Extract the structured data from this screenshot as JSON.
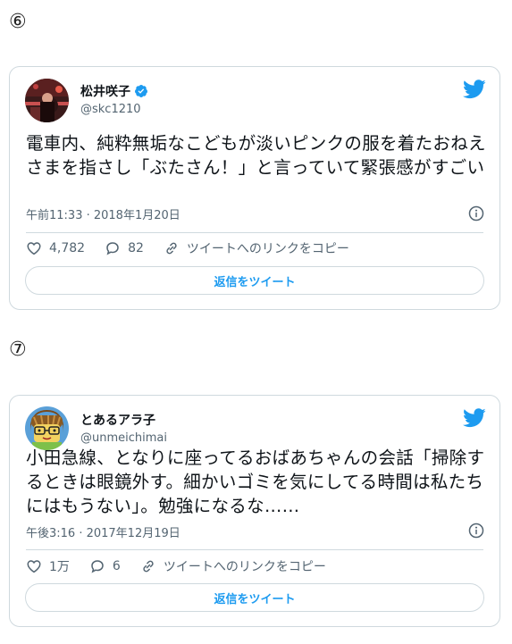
{
  "section_numbers": [
    "⑥",
    "⑦"
  ],
  "tweets": [
    {
      "author_name": "松井咲子",
      "verified": true,
      "handle": "@skc1210",
      "text": "電車内、純粋無垢なこどもが淡いピンクの服を着たおねえさまを指さし「ぶたさん！」と言っていて緊張感がすごい",
      "time": "午前11:33 · 2018年1月20日",
      "likes": "4,782",
      "replies": "82",
      "copy_link_label": "ツイートへのリンクをコピー",
      "reply_button_label": "返信をツイート"
    },
    {
      "author_name": "とあるアラ子",
      "verified": false,
      "handle": "@unmeichimai",
      "text": "小田急線、となりに座ってるおばあちゃんの会話「掃除するときは眼鏡外す。細かいゴミを気にしてる時間は私たちにはもうない」。勉強になるな……",
      "time": "午後3:16 · 2017年12月19日",
      "likes": "1万",
      "replies": "6",
      "copy_link_label": "ツイートへのリンクをコピー",
      "reply_button_label": "返信をツイート"
    }
  ],
  "colors": {
    "twitter_blue": "#1d9bf0",
    "muted_text": "#536471",
    "border": "#cfd9de"
  },
  "icons": {
    "brand": "twitter-bird-icon",
    "verified": "verified-badge-icon",
    "info": "info-icon",
    "like": "heart-icon",
    "reply": "speech-bubble-icon",
    "copy_link": "link-icon"
  }
}
